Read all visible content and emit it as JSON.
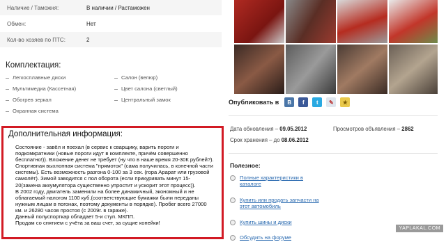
{
  "specs": [
    {
      "key": "Наличие / Таможня:",
      "value": "В наличии / Растаможен"
    },
    {
      "key": "Обмен:",
      "value": "Нет"
    },
    {
      "key": "Кол-во хозяев по ПТС:",
      "value": "2"
    }
  ],
  "equipment": {
    "title": "Комплектация:",
    "left": [
      "Легкосплавные диски",
      "Мультимедиа (Кассетная)",
      "Обогрев зеркал",
      "Охранная система"
    ],
    "right": [
      "Салон (велюр)",
      "Цвет салона (светлый)",
      "Центральный замок"
    ]
  },
  "info": {
    "title": "Дополнительная информация:",
    "lines": [
      "Состояние - завёл и поехал (в сервис к сварщику, варить пороги и",
      "подкомкратники (новые пороги идут в комплекте, причём совершенно",
      "бесплатно!)). Вложение денег не требует (ну что в наше время 20-30К рублей?).",
      "Спортивная выхлопная система \"прямоток\" (сама получилась, в конечной части",
      "системы). Есть возможность разгона 0-100 за 3 сек. (гора Арарат или грузовой",
      "самолёт). Зимой заводится с пол оборота (если прикуривать минут 15-",
      "20(замена аккумулятора существенно упростит и ускорит этот процесс)).",
      "В 2002 году, двигатель заменили на более динамичный, экономный и не",
      "облагаемый налогом 1100 куб.(соответствующие бумажки были переданы",
      "нужным лицам в погонах, поэтому документы в порядке). Пробег всего 27000",
      "км. и 26280 часов простоя (с 2009г. в гараже).",
      "Данный полуспорткар обладает 5-и ступ. МКПП.",
      "Продам со снятием с учёта за ваш счет, за сущие копейки!"
    ]
  },
  "publish": {
    "label": "Опубликовать в",
    "services": [
      {
        "icon": "vk-icon",
        "glyph": "В",
        "color": "#4a76a8"
      },
      {
        "icon": "facebook-icon",
        "glyph": "f",
        "color": "#3b5998"
      },
      {
        "icon": "twitter-icon",
        "glyph": "t",
        "color": "#29a9e1"
      },
      {
        "icon": "livejournal-icon",
        "glyph": "✎",
        "color": "#dfe6ee"
      },
      {
        "icon": "bookmark-icon",
        "glyph": "★",
        "color": "#e9c84a"
      }
    ]
  },
  "meta": {
    "updated_label": "Дата обновления –",
    "updated_value": "09.05.2012",
    "views_label": "Просмотров объявления –",
    "views_value": "2862",
    "expiry_label": "Срок хранения – до",
    "expiry_value": "08.06.2012"
  },
  "useful": {
    "title": "Полезное:",
    "items": [
      [
        "Полные характеристики в",
        "каталоге"
      ],
      [
        "Купить или продать запчасти на",
        "этот автомобиль"
      ],
      [
        "Купить шины и диски"
      ],
      [
        "Обсудить на форуме"
      ]
    ]
  },
  "watermark": "YAPLAKAL.COM"
}
